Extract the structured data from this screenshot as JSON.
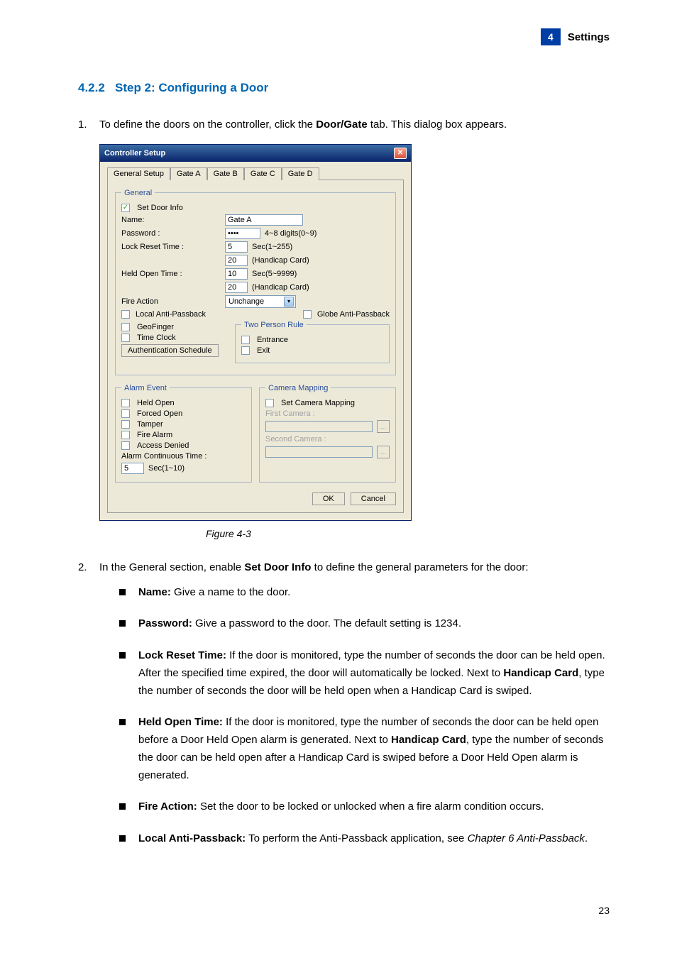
{
  "header": {
    "badge_num": "4",
    "badge_text": "Settings"
  },
  "section": {
    "number": "4.2.2",
    "title": "Step 2: Configuring a Door"
  },
  "step1": {
    "num": "1.",
    "text_before": "To define the doors on the controller, click the ",
    "bold1": "Door/Gate",
    "text_after": " tab. This dialog box appears."
  },
  "dialog": {
    "title": "Controller Setup",
    "tabs": [
      "General Setup",
      "Gate A",
      "Gate B",
      "Gate C",
      "Gate D"
    ],
    "general_legend": "General",
    "set_door_info": "Set Door Info",
    "name_label": "Name:",
    "name_value": "Gate A",
    "password_label": "Password :",
    "password_value": "••••",
    "password_hint": "4~8 digits(0~9)",
    "lock_reset_label": "Lock Reset Time :",
    "lock_reset_v1": "5",
    "lock_reset_h1": "Sec(1~255)",
    "lock_reset_v2": "20",
    "lock_reset_h2": "(Handicap Card)",
    "held_open_label": "Held Open Time :",
    "held_open_v1": "10",
    "held_open_h1": "Sec(5~9999)",
    "held_open_v2": "20",
    "held_open_h2": "(Handicap Card)",
    "fire_action_label": "Fire Action",
    "fire_action_value": "Unchange",
    "local_apb": "Local Anti-Passback",
    "globe_apb": "Globe Anti-Passback",
    "geofinger": "GeoFinger",
    "two_person_legend": "Two Person Rule",
    "timeclock": "Time Clock",
    "entrance": "Entrance",
    "exit": "Exit",
    "auth_sched": "Authentication Schedule",
    "alarm_legend": "Alarm Event",
    "alarm_held": "Held Open",
    "alarm_forced": "Forced Open",
    "alarm_tamper": "Tamper",
    "alarm_fire": "Fire Alarm",
    "alarm_denied": "Access Denied",
    "alarm_cont": "Alarm Continuous Time :",
    "alarm_cont_v": "5",
    "alarm_cont_h": "Sec(1~10)",
    "camera_legend": "Camera Mapping",
    "set_camera": "Set Camera Mapping",
    "first_camera": "First Camera :",
    "second_camera": "Second Camera :",
    "ok": "OK",
    "cancel": "Cancel"
  },
  "figure_caption": "Figure 4-3",
  "step2": {
    "num": "2.",
    "text_before": "In the General section, enable ",
    "bold1": "Set Door Info",
    "text_after": " to define the general parameters for the door:"
  },
  "bullets": {
    "name": {
      "bold": "Name:",
      "text": " Give a name to the door."
    },
    "password": {
      "bold": "Password:",
      "text": " Give a password to the door. The default setting is 1234."
    },
    "lockreset": {
      "bold": "Lock Reset Time:",
      "p": " If the door is monitored, type the number of seconds the door can be held open. After the specified time expired, the door will automatically be locked. Next to ",
      "bold2": "Handicap Card",
      "p2": ", type the number of seconds the door will be held open when a Handicap Card is swiped."
    },
    "heldopen": {
      "bold": "Held Open Time:",
      "p": " If the door is monitored, type the number of seconds the door can be held open before a Door Held Open alarm is generated. Next to ",
      "bold2": "Handicap Card",
      "p2": ", type the number of seconds the door can be held open after a Handicap Card is swiped before a Door Held Open alarm is generated."
    },
    "fireaction": {
      "bold": "Fire Action:",
      "text": " Set the door to be locked or unlocked when a fire alarm condition occurs."
    },
    "localapb": {
      "bold": "Local Anti-Passback:",
      "text": " To perform the Anti-Passback application, see ",
      "italic": "Chapter 6 Anti-Passback",
      "after": "."
    }
  },
  "pagenum": "23"
}
